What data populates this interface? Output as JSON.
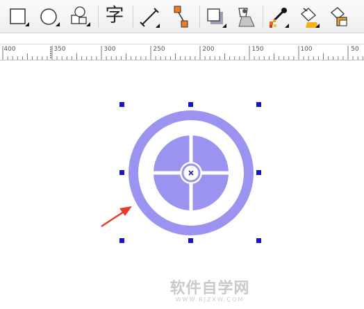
{
  "toolbar": {
    "tools": [
      {
        "name": "rectangle-tool",
        "icon": "rectangle-icon"
      },
      {
        "name": "ellipse-tool",
        "icon": "ellipse-icon"
      },
      {
        "name": "basic-shapes-tool",
        "icon": "shapes-icon"
      },
      {
        "name": "text-tool",
        "icon": "text-icon",
        "glyph": "字"
      },
      {
        "name": "dimension-tool",
        "icon": "dimension-icon"
      },
      {
        "name": "connector-tool",
        "icon": "connector-icon"
      },
      {
        "name": "drop-shadow-tool",
        "icon": "drop-shadow-icon"
      },
      {
        "name": "transparency-tool",
        "icon": "transparency-icon"
      },
      {
        "name": "eyedropper-tool",
        "icon": "eyedropper-icon"
      },
      {
        "name": "fill-tool",
        "icon": "paint-bucket-icon"
      },
      {
        "name": "interactive-fill-tool",
        "icon": "interactive-fill-icon"
      }
    ]
  },
  "ruler": {
    "labels": [
      "400",
      "350",
      "300",
      "250",
      "200",
      "150",
      "100",
      "50"
    ]
  },
  "canvas": {
    "shape_color": "#9b93f0",
    "handle_color": "#1414d2",
    "arrow_color": "#e8392c",
    "center_mark_color": "#1a1ab0"
  },
  "watermark": {
    "main": "软件自学网",
    "sub": "WWW.RJZXW.COM"
  }
}
